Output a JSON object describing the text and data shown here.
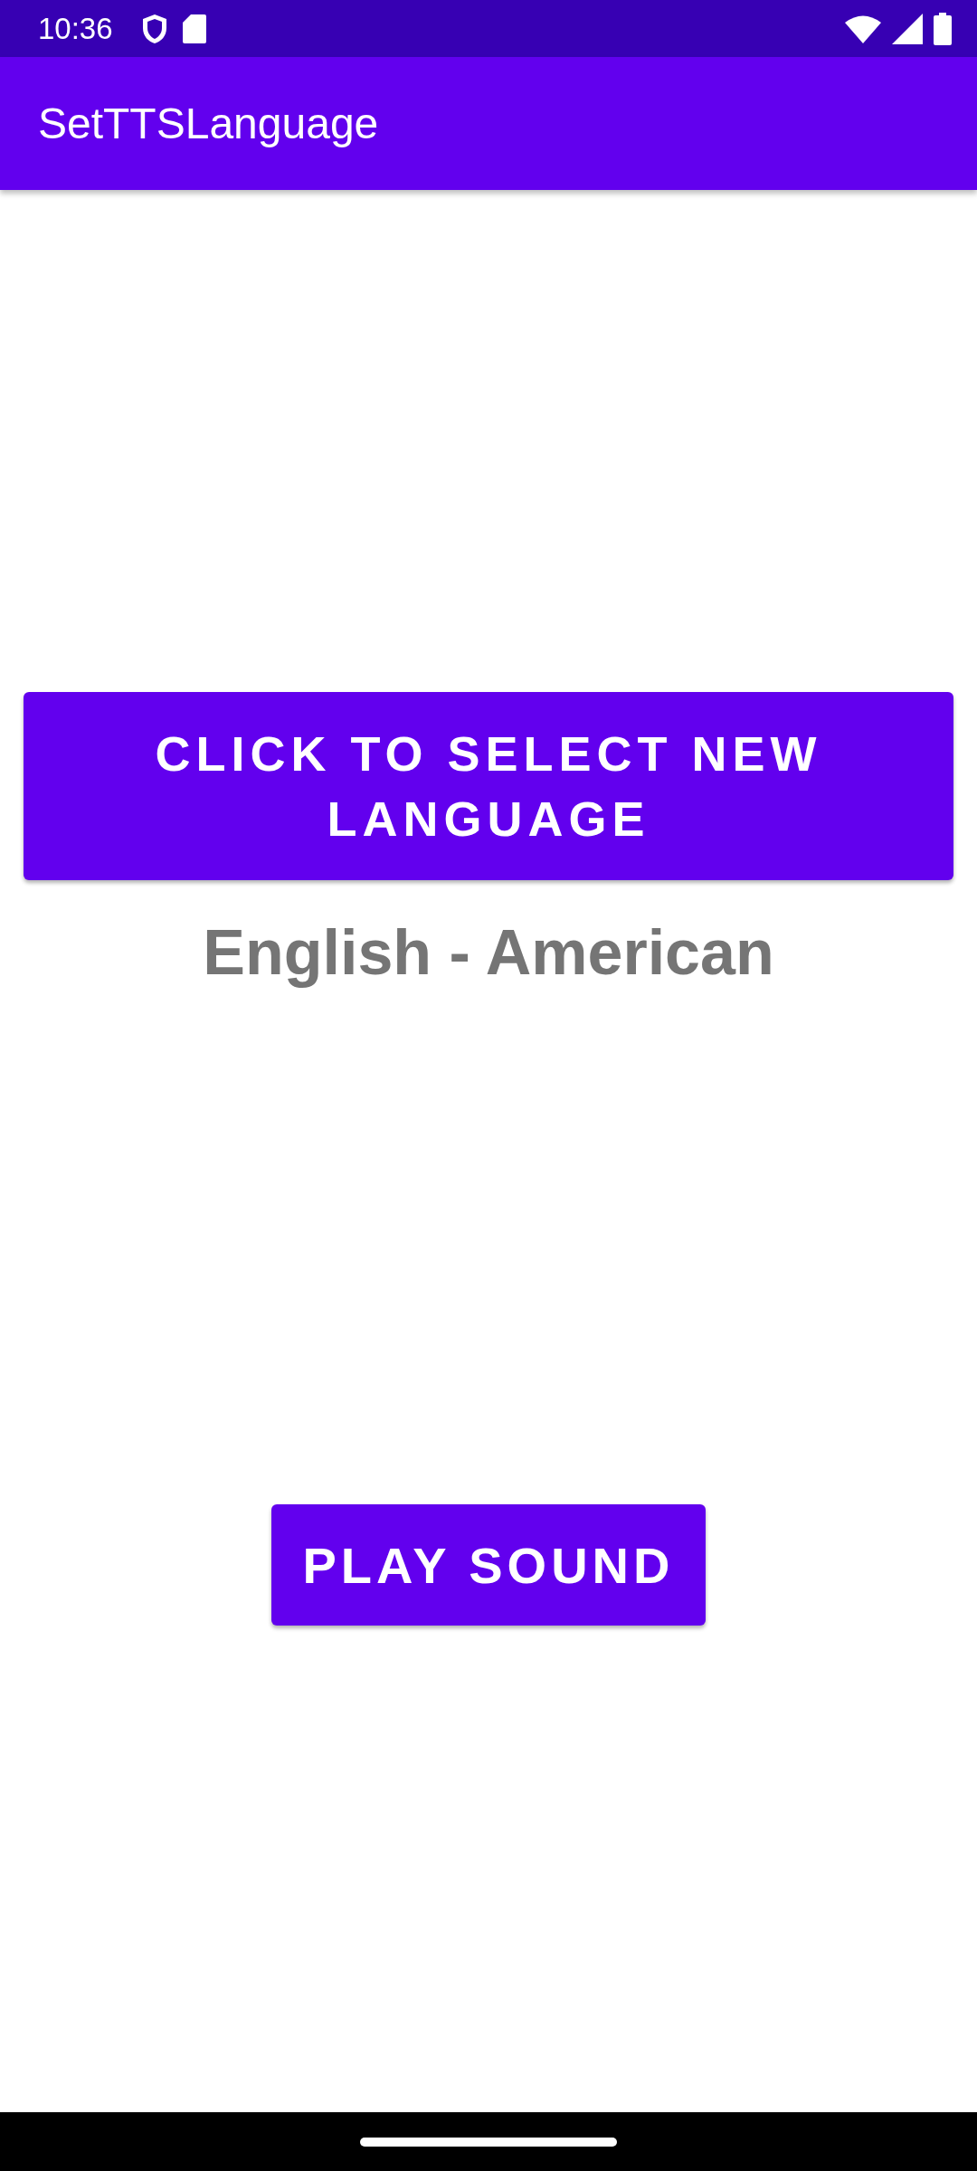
{
  "status_bar": {
    "time": "10:36"
  },
  "app_bar": {
    "title": "SetTTSLanguage"
  },
  "select_button": {
    "label": "CLICK TO SELECT NEW LANGUAGE"
  },
  "language": "English - American",
  "play_button": {
    "label": "PLAY SOUND"
  }
}
